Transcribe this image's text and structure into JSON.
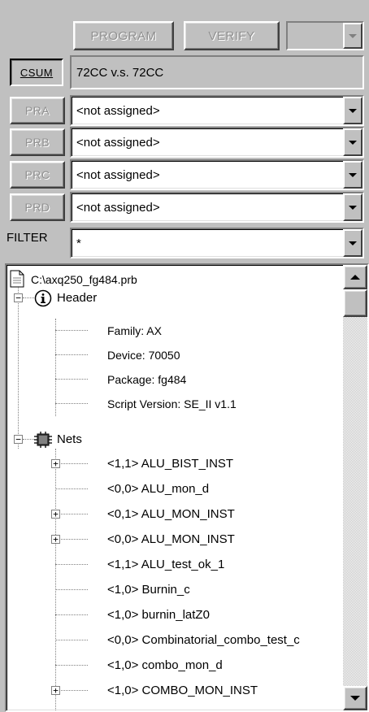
{
  "toolbar": {
    "program_label": "PROGRAM",
    "verify_label": "VERIFY",
    "device_dropdown_value": ""
  },
  "csum": {
    "button_label": "CSUM",
    "value": "72CC v.s. 72CC"
  },
  "assignments": [
    {
      "button_label": "PRA",
      "value": "<not assigned>"
    },
    {
      "button_label": "PRB",
      "value": "<not assigned>"
    },
    {
      "button_label": "PRC",
      "value": "<not assigned>"
    },
    {
      "button_label": "PRD",
      "value": "<not assigned>"
    }
  ],
  "filter": {
    "label": "FILTER",
    "value": "*"
  },
  "tree": {
    "root": {
      "icon": "file-icon",
      "label": "C:\\axq250_fg484.prb"
    },
    "header": {
      "icon": "info-icon",
      "label": "Header",
      "expander": "−",
      "children": [
        "Family: AX",
        "Device: 70050",
        "Package: fg484",
        "Script Version: SE_II v1.1"
      ]
    },
    "nets": {
      "icon": "chip-icon",
      "label": "Nets",
      "expander": "−",
      "children": [
        {
          "label": "<1,1> ALU_BIST_INST",
          "expandable": true
        },
        {
          "label": "<0,0> ALU_mon_d",
          "expandable": false
        },
        {
          "label": "<0,1> ALU_MON_INST",
          "expandable": true
        },
        {
          "label": "<0,0> ALU_MON_INST",
          "expandable": true
        },
        {
          "label": "<1,1> ALU_test_ok_1",
          "expandable": false
        },
        {
          "label": "<1,0> Burnin_c",
          "expandable": false
        },
        {
          "label": "<1,0> burnin_latZ0",
          "expandable": false
        },
        {
          "label": "<0,0> Combinatorial_combo_test_c",
          "expandable": false
        },
        {
          "label": "<1,0> combo_mon_d",
          "expandable": false
        },
        {
          "label": "<1,0> COMBO_MON_INST",
          "expandable": true
        }
      ]
    }
  }
}
